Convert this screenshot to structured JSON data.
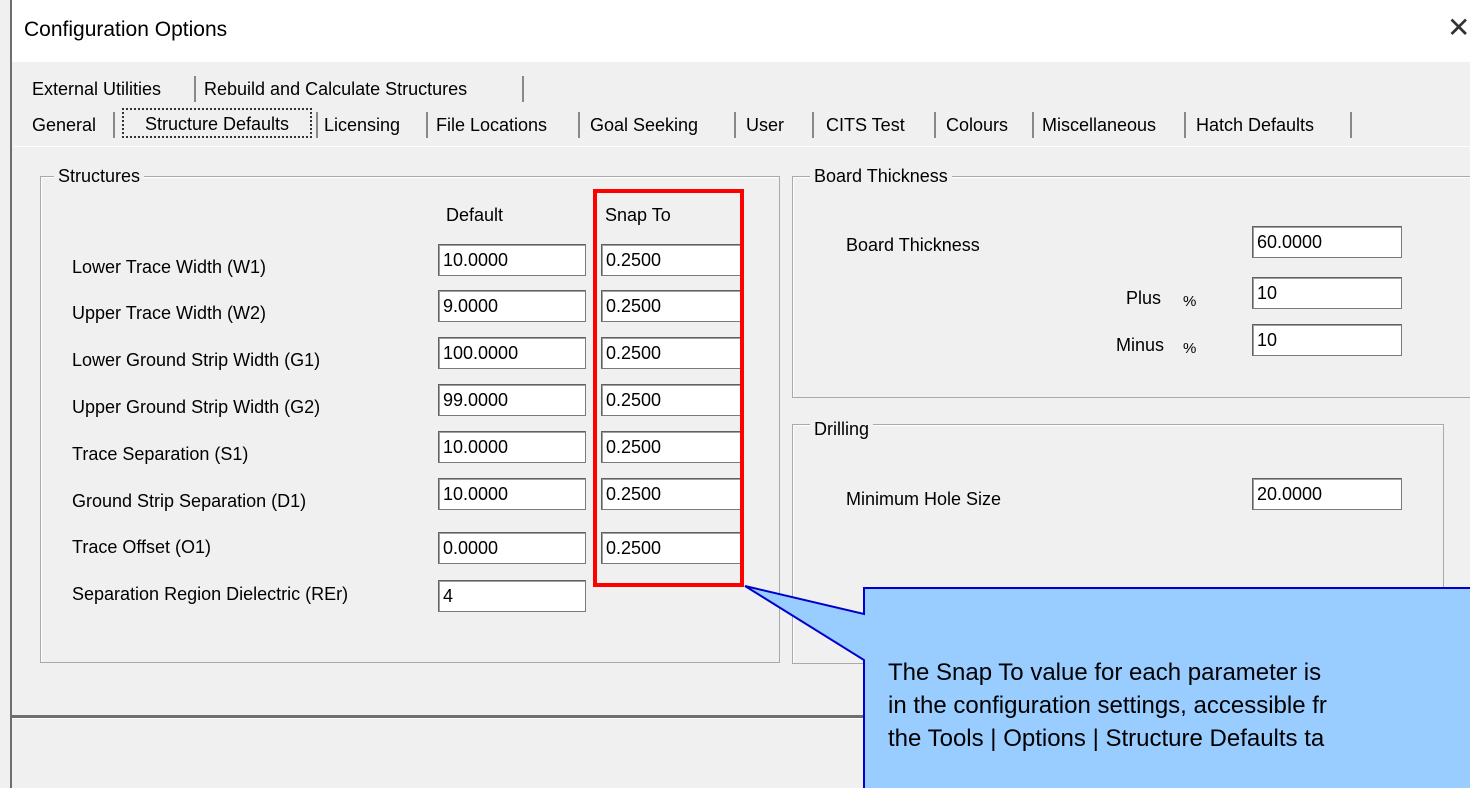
{
  "window": {
    "title": "Configuration Options",
    "close_glyph": "✕"
  },
  "tabs_row1": [
    {
      "label": "External Utilities"
    },
    {
      "label": "Rebuild and Calculate Structures"
    }
  ],
  "tabs_row2": [
    {
      "label": "General"
    },
    {
      "label": "Structure Defaults",
      "active": true
    },
    {
      "label": "Licensing"
    },
    {
      "label": "File Locations"
    },
    {
      "label": "Goal Seeking"
    },
    {
      "label": "User"
    },
    {
      "label": "CITS Test"
    },
    {
      "label": "Colours"
    },
    {
      "label": "Miscellaneous"
    },
    {
      "label": "Hatch Defaults"
    }
  ],
  "structures": {
    "group_label": "Structures",
    "col_default": "Default",
    "col_snap": "Snap To",
    "rows": [
      {
        "label": "Lower Trace Width (W1)",
        "default": "10.0000",
        "snap": "0.2500"
      },
      {
        "label": "Upper Trace Width (W2)",
        "default": "9.0000",
        "snap": "0.2500"
      },
      {
        "label": "Lower Ground Strip Width (G1)",
        "default": "100.0000",
        "snap": "0.2500"
      },
      {
        "label": "Upper Ground Strip Width (G2)",
        "default": "99.0000",
        "snap": "0.2500"
      },
      {
        "label": "Trace Separation (S1)",
        "default": "10.0000",
        "snap": "0.2500"
      },
      {
        "label": "Ground Strip Separation (D1)",
        "default": "10.0000",
        "snap": "0.2500"
      },
      {
        "label": "Trace Offset (O1)",
        "default": "0.0000",
        "snap": "0.2500"
      },
      {
        "label": "Separation Region Dielectric (REr)",
        "default": "4"
      }
    ]
  },
  "board": {
    "group_label": "Board Thickness",
    "thickness_label": "Board Thickness",
    "thickness_value": "60.0000",
    "plus_label": "Plus",
    "plus_unit": "%",
    "plus_value": "10",
    "minus_label": "Minus",
    "minus_unit": "%",
    "minus_value": "10"
  },
  "drilling": {
    "group_label": "Drilling",
    "min_hole_label": "Minimum Hole Size",
    "min_hole_value": "20.0000"
  },
  "callout": {
    "line1": "The Snap To value for each parameter is",
    "line2": "in the configuration settings, accessible fr",
    "line3": "the Tools | Options | Structure Defaults ta",
    "fill_color": "#99ccff",
    "border_color": "#0000cc"
  },
  "highlight_color": "#ff0000"
}
